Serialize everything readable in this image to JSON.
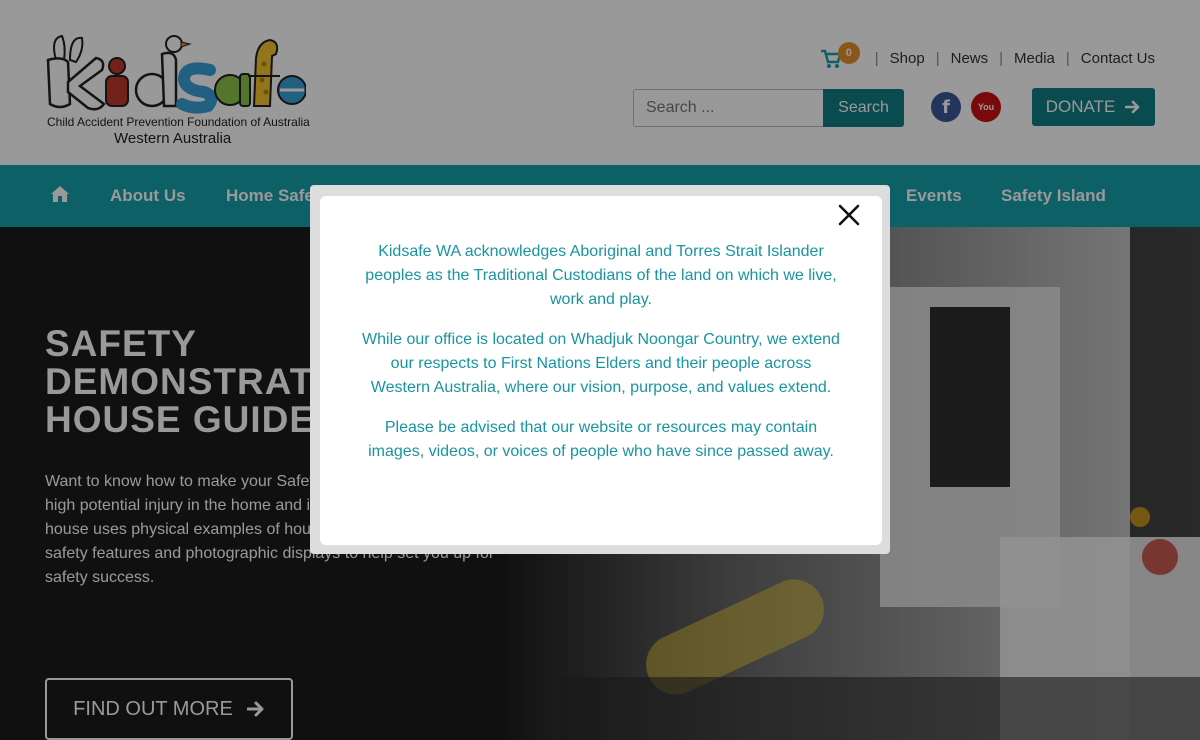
{
  "logo": {
    "wordmark": "Kidsafe",
    "subtitle": "Child Accident Prevention Foundation of Australia",
    "region": "Western Australia"
  },
  "top_links": {
    "cart_count": "0",
    "items": [
      "Shop",
      "News",
      "Media",
      "Contact Us"
    ]
  },
  "search": {
    "placeholder": "Search ...",
    "button_label": "Search"
  },
  "social": {
    "facebook_glyph": "f",
    "youtube_glyph": "You"
  },
  "donate_label": "DONATE",
  "nav": {
    "items": [
      "About Us",
      "Home Safe",
      "Events",
      "Safety Island"
    ]
  },
  "hero": {
    "title_lines": [
      "SAFETY",
      "DEMONSTRAT",
      "HOUSE GUIDE"
    ],
    "description": "Want to know how to make your Safety Demonstration House high potential injury in the home and injury! The Safety Demo house uses physical examples of household items with child safety features and photographic displays to help set you up for safety success.",
    "cta_label": "FIND OUT MORE"
  },
  "modal": {
    "paragraphs": [
      "Kidsafe WA acknowledges Aboriginal and Torres Strait Islander peoples as the Traditional Custodians of the land on which we live, work and play.",
      "While our office is located on Whadjuk Noongar Country, we extend our respects to First Nations Elders and their people across Western Australia, where our vision, purpose, and values extend.",
      "Please be advised that our website or resources may contain images, videos, or voices of people who have since passed away."
    ]
  },
  "colors": {
    "brand_teal": "#14a0aa",
    "button_teal": "#117e86",
    "cart_badge": "#e8902c",
    "modal_text": "#1895a0"
  }
}
